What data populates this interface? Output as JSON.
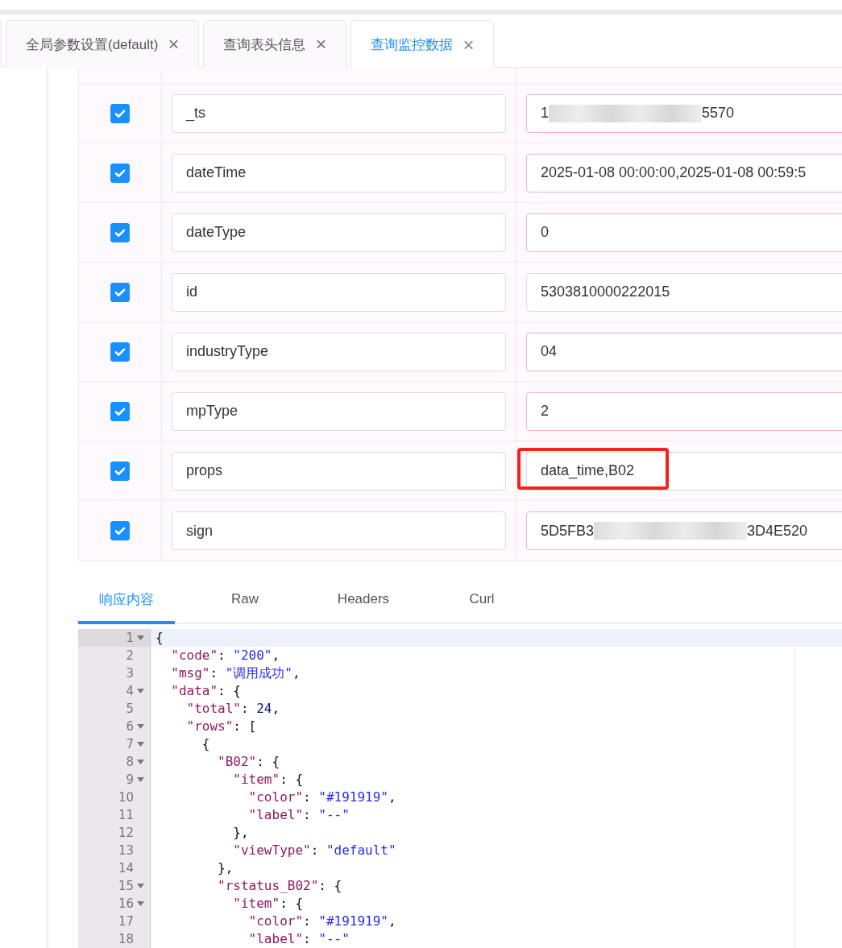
{
  "tabs": [
    {
      "label": "全局参数设置(default)",
      "selected": false,
      "close": "×"
    },
    {
      "label": "查询表头信息",
      "selected": false,
      "close": "×"
    },
    {
      "label": "查询监控数据",
      "selected": true,
      "close": "×"
    }
  ],
  "params": [
    {
      "checked": true,
      "name": "_ts",
      "kind": "redacted",
      "value_start": "1",
      "value_end": "5570",
      "error": true,
      "highlighted": false
    },
    {
      "checked": true,
      "name": "dateTime",
      "kind": "plain",
      "value": "2025-01-08 00:00:00,2025-01-08 00:59:5",
      "error": true,
      "highlighted": false
    },
    {
      "checked": true,
      "name": "dateType",
      "kind": "plain",
      "value": "0",
      "error": true,
      "highlighted": false
    },
    {
      "checked": true,
      "name": "id",
      "kind": "plain",
      "value": "5303810000222015",
      "error": false,
      "highlighted": false
    },
    {
      "checked": true,
      "name": "industryType",
      "kind": "plain",
      "value": "04",
      "error": true,
      "highlighted": false
    },
    {
      "checked": true,
      "name": "mpType",
      "kind": "plain",
      "value": "2",
      "error": true,
      "highlighted": false
    },
    {
      "checked": true,
      "name": "props",
      "kind": "plain",
      "value": "data_time,B02",
      "error": false,
      "highlighted": true
    },
    {
      "checked": true,
      "name": "sign",
      "kind": "redacted",
      "value_start": "5D5FB3",
      "value_end": "3D4E520",
      "error": true,
      "highlighted": false
    }
  ],
  "response_tabs": [
    {
      "label": "响应内容",
      "selected": true
    },
    {
      "label": "Raw",
      "selected": false
    },
    {
      "label": "Headers",
      "selected": false
    },
    {
      "label": "Curl",
      "selected": false
    }
  ],
  "editor": {
    "lines": [
      {
        "number": "1",
        "foldable": true,
        "active": true,
        "text": "{"
      },
      {
        "number": "2",
        "foldable": false,
        "active": false,
        "text": "  \"code\": \"200\","
      },
      {
        "number": "3",
        "foldable": false,
        "active": false,
        "text": "  \"msg\": \"调用成功\","
      },
      {
        "number": "4",
        "foldable": true,
        "active": false,
        "text": "  \"data\": {"
      },
      {
        "number": "5",
        "foldable": false,
        "active": false,
        "text": "    \"total\": 24,"
      },
      {
        "number": "6",
        "foldable": true,
        "active": false,
        "text": "    \"rows\": ["
      },
      {
        "number": "7",
        "foldable": true,
        "active": false,
        "text": "      {"
      },
      {
        "number": "8",
        "foldable": true,
        "active": false,
        "text": "        \"B02\": {"
      },
      {
        "number": "9",
        "foldable": true,
        "active": false,
        "text": "          \"item\": {"
      },
      {
        "number": "10",
        "foldable": false,
        "active": false,
        "text": "            \"color\": \"#191919\","
      },
      {
        "number": "11",
        "foldable": false,
        "active": false,
        "text": "            \"label\": \"--\""
      },
      {
        "number": "12",
        "foldable": false,
        "active": false,
        "text": "          },"
      },
      {
        "number": "13",
        "foldable": false,
        "active": false,
        "text": "          \"viewType\": \"default\""
      },
      {
        "number": "14",
        "foldable": false,
        "active": false,
        "text": "        },"
      },
      {
        "number": "15",
        "foldable": true,
        "active": false,
        "text": "        \"rstatus_B02\": {"
      },
      {
        "number": "16",
        "foldable": true,
        "active": false,
        "text": "          \"item\": {"
      },
      {
        "number": "17",
        "foldable": false,
        "active": false,
        "text": "            \"color\": \"#191919\","
      },
      {
        "number": "18",
        "foldable": false,
        "active": false,
        "text": "            \"label\": \"--\""
      }
    ]
  }
}
